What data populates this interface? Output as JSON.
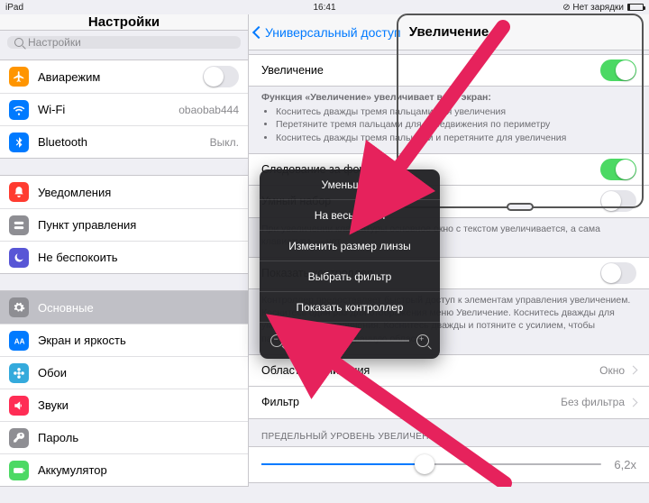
{
  "statusbar": {
    "device": "iPad",
    "time": "16:41",
    "charge_label": "Нет зарядки"
  },
  "sidebar": {
    "title": "Настройки",
    "search_placeholder": "Настройки",
    "groups": [
      [
        {
          "icon": "airplane",
          "color": "#ff9500",
          "label": "Авиарежим",
          "accessory": "switch",
          "on": false
        },
        {
          "icon": "wifi",
          "color": "#007aff",
          "label": "Wi-Fi",
          "value": "obaobab444"
        },
        {
          "icon": "bluetooth",
          "color": "#007aff",
          "label": "Bluetooth",
          "value": "Выкл."
        }
      ],
      [
        {
          "icon": "bell",
          "color": "#ff3b30",
          "label": "Уведомления"
        },
        {
          "icon": "toggles",
          "color": "#8e8e93",
          "label": "Пункт управления"
        },
        {
          "icon": "moon",
          "color": "#5856d6",
          "label": "Не беспокоить"
        }
      ],
      [
        {
          "icon": "gear",
          "color": "#8e8e93",
          "label": "Основные",
          "selected": true
        },
        {
          "icon": "aa",
          "color": "#007aff",
          "label": "Экран и яркость"
        },
        {
          "icon": "flower",
          "color": "#34aadc",
          "label": "Обои"
        },
        {
          "icon": "speaker",
          "color": "#ff2d55",
          "label": "Звуки"
        },
        {
          "icon": "key",
          "color": "#8e8e93",
          "label": "Пароль"
        },
        {
          "icon": "battery",
          "color": "#4cd964",
          "label": "Аккумулятор"
        }
      ]
    ]
  },
  "detail": {
    "back": "Универсальный доступ",
    "title": "Увеличение",
    "rows": {
      "zoom_label": "Увеличение",
      "follow_focus": "Следование за фокусом",
      "smart_typing": "Умный набор",
      "show_controller": "Показать контроллер",
      "zoom_area_label": "Область увеличения",
      "zoom_area_value": "Окно",
      "filter_label": "Фильтр",
      "filter_value": "Без фильтра",
      "max_level_header": "ПРЕДЕЛЬНЫЙ УРОВЕНЬ УВЕЛИЧЕНИЯ",
      "max_level_value": "6,2x"
    },
    "hint_header": "Функция «Увеличение» увеличивает весь экран:",
    "hints": [
      "Коснитесь дважды тремя пальцами для увеличения",
      "Перетяните тремя пальцами для передвижения по периметру",
      "Коснитесь дважды тремя пальцами и перетяните для увеличения"
    ],
    "smart_hint": "При увеличении клавиатуры основное окно с текстом увеличивается, а сама клавиатура — нет.",
    "controller_hint1": "Контроллер предоставляет быстрый доступ к элементам управления увеличением.",
    "controller_hint2": "Коснитесь один раз для отображения меню Увеличение. Коснитесь дважды для уменьшения и увеличения. Коснитесь дважды и потяните с усилием, чтобы панорамировать выбранную область."
  },
  "popover": {
    "items": [
      "Уменьшить",
      "На весь экран",
      "Изменить размер линзы",
      "Выбрать фильтр",
      "Показать контроллер"
    ]
  }
}
